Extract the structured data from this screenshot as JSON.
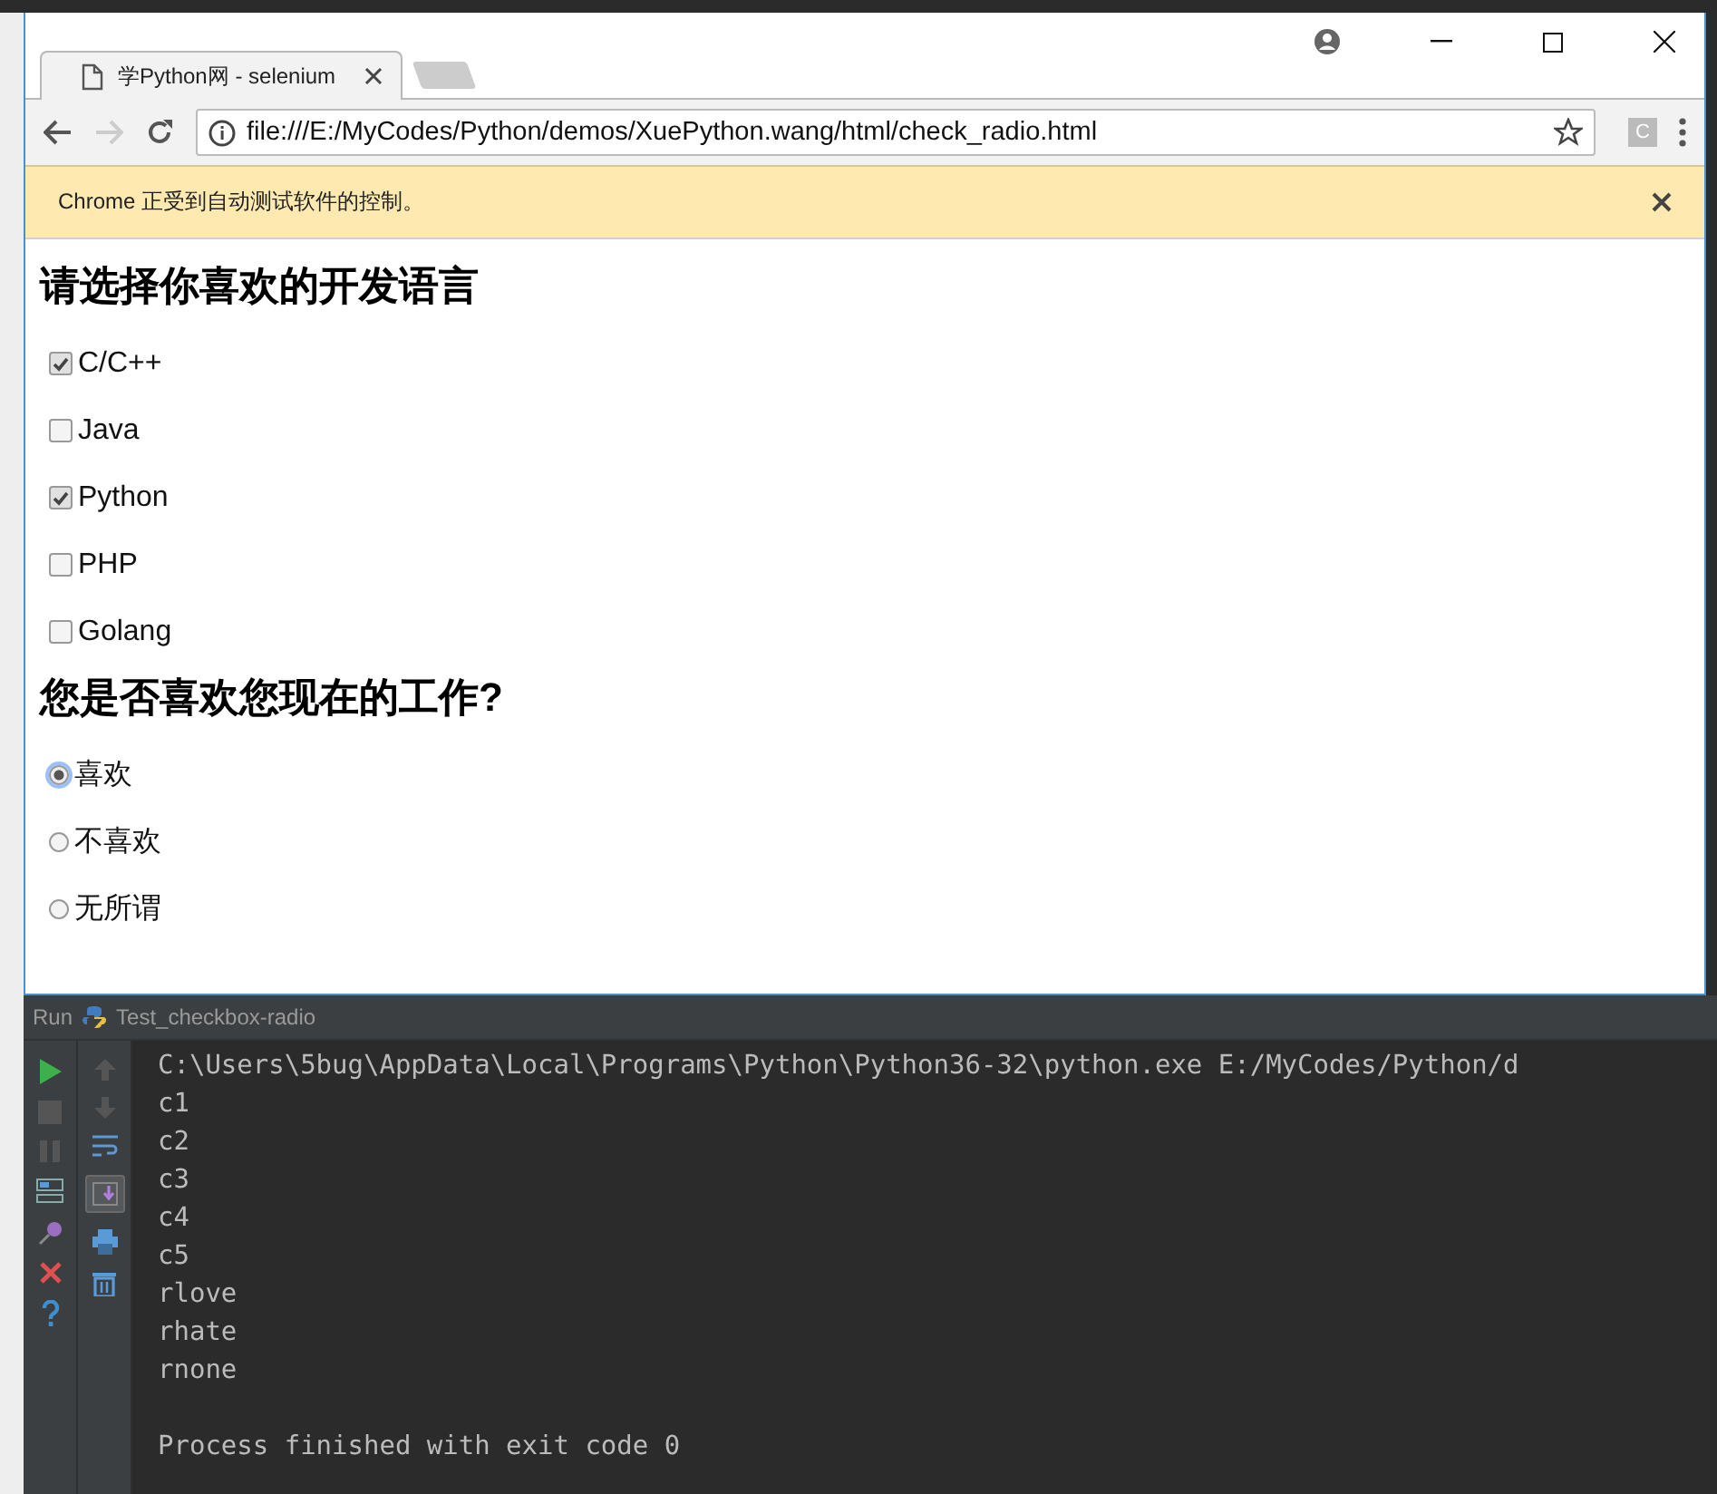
{
  "browser": {
    "tab": {
      "title": "学Python网 - selenium"
    },
    "address": "file:///E:/MyCodes/Python/demos/XuePython.wang/html/check_radio.html",
    "extension_label": "C",
    "infobar": "Chrome 正受到自动测试软件的控制。",
    "page": {
      "sections": [
        {
          "heading": "请选择你喜欢的开发语言",
          "kind": "checkbox",
          "options": [
            {
              "label": "C/C++",
              "checked": true
            },
            {
              "label": "Java",
              "checked": false
            },
            {
              "label": "Python",
              "checked": true
            },
            {
              "label": "PHP",
              "checked": false
            },
            {
              "label": "Golang",
              "checked": false
            }
          ]
        },
        {
          "heading": "您是否喜欢您现在的工作?",
          "kind": "radio",
          "options": [
            {
              "label": "喜欢",
              "checked": true
            },
            {
              "label": "不喜欢",
              "checked": false
            },
            {
              "label": "无所谓",
              "checked": false
            }
          ]
        }
      ]
    }
  },
  "run_panel": {
    "label": "Run",
    "config": "Test_checkbox-radio",
    "console": {
      "lines": [
        "C:\\Users\\5bug\\AppData\\Local\\Programs\\Python\\Python36-32\\python.exe E:/MyCodes/Python/d",
        "c1",
        "c2",
        "c3",
        "c4",
        "c5",
        "rlove",
        "rhate",
        "rnone"
      ],
      "exit_message": "Process finished with exit code 0"
    }
  }
}
